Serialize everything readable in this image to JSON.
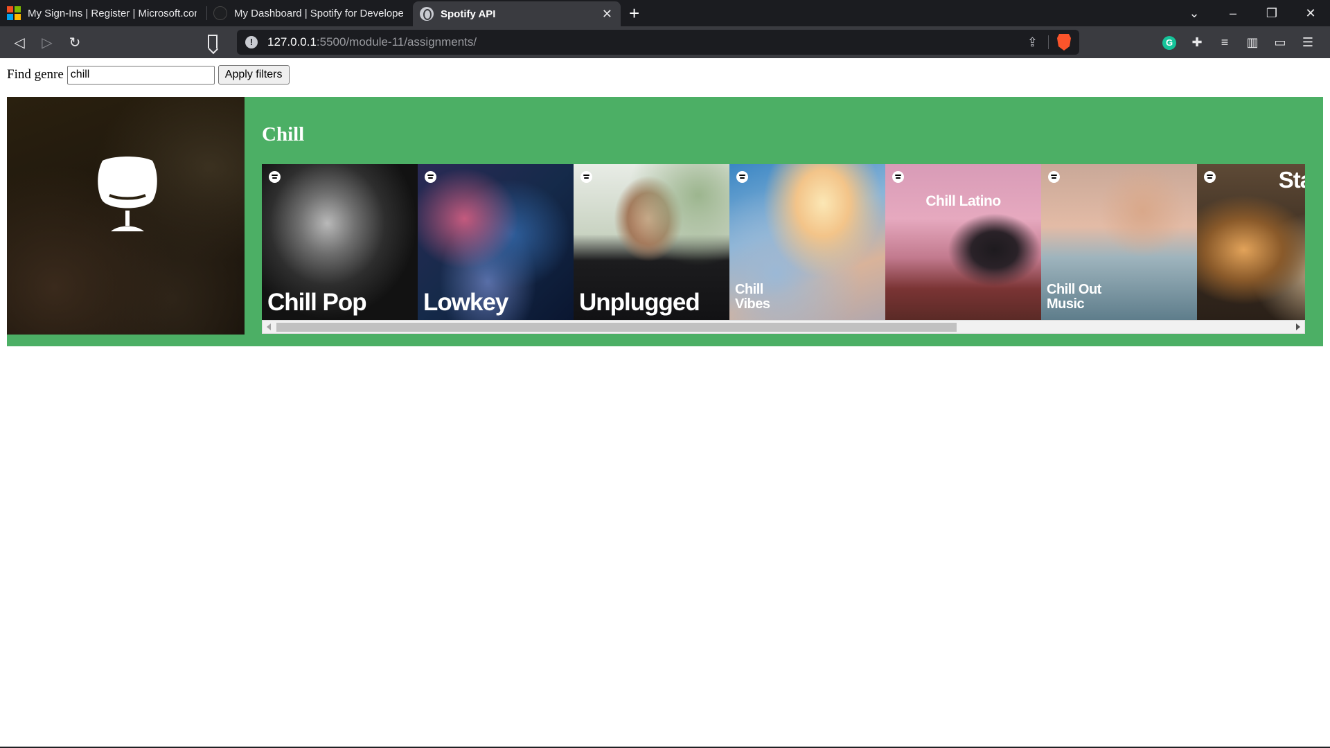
{
  "browser": {
    "tabs": [
      {
        "title": "My Sign-Ins | Register | Microsoft.com",
        "active": false
      },
      {
        "title": "My Dashboard | Spotify for Developers",
        "active": false
      },
      {
        "title": "Spotify API",
        "active": true
      }
    ],
    "url_host": "127.0.0.1",
    "url_path": ":5500/module-11/assignments/"
  },
  "filter": {
    "label": "Find genre",
    "value": "chill",
    "button_label": "Apply filters"
  },
  "genre": {
    "name": "Chill",
    "playlists": [
      {
        "title": "Chill Pop"
      },
      {
        "title": "Lowkey"
      },
      {
        "title": "Unplugged"
      },
      {
        "title_line1": "Chill",
        "title_line2": "Vibes"
      },
      {
        "title": "Chill Latino"
      },
      {
        "title_line1": "Chill Out",
        "title_line2": "Music"
      },
      {
        "title": "Stay in"
      }
    ]
  },
  "colors": {
    "card_background": "#4caf65",
    "toolbar": "#3a3b40",
    "tabstrip": "#1b1c20"
  }
}
